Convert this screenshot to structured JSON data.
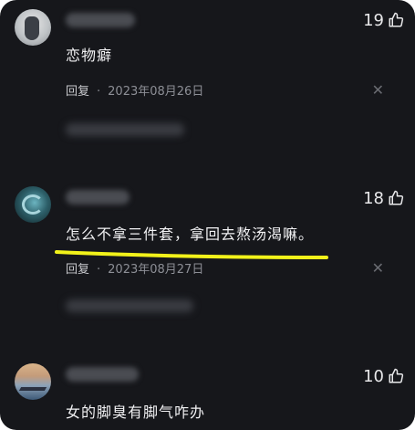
{
  "comments": [
    {
      "likes": "19",
      "text": "恋物癖",
      "reply_label": "回复",
      "separator": "·",
      "date": "2023年08月26日"
    },
    {
      "likes": "18",
      "text": "怎么不拿三件套，拿回去熬汤渴嘛。",
      "reply_label": "回复",
      "separator": "·",
      "date": "2023年08月27日"
    },
    {
      "likes": "10",
      "text": "女的脚臭有脚气咋办"
    }
  ],
  "icons": {
    "like": "thumbs-up-icon",
    "dismiss": "close-icon"
  },
  "colors": {
    "background": "#16171b",
    "highlight_underline": "#f2f21a"
  }
}
